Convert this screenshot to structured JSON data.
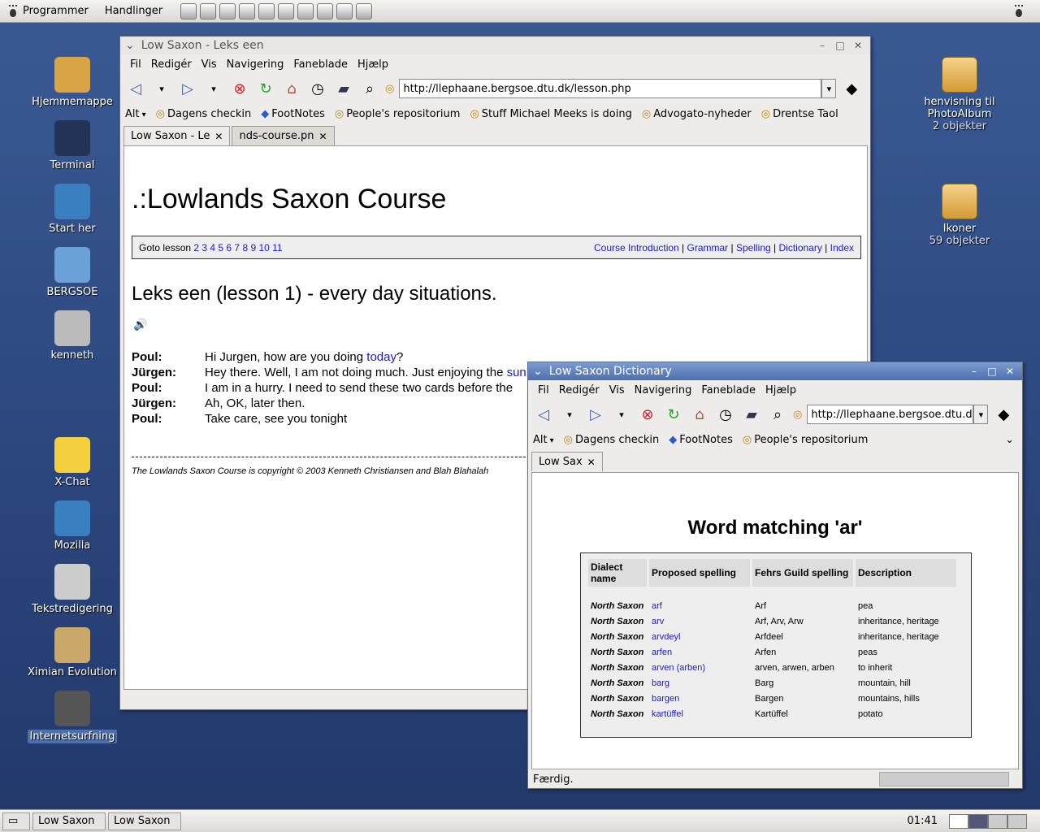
{
  "topbar": {
    "apps": "Programmer",
    "actions": "Handlinger",
    "launchers": [
      "notes-icon",
      "laptop-icon",
      "monitor-icon",
      "calculator-icon",
      "mail-icon",
      "edit-icon",
      "document-icon",
      "red-icon",
      "window-icon",
      "gnome-icon"
    ]
  },
  "desktop": {
    "left": [
      {
        "label": "Hjemmemappe",
        "icon": "home-folder-icon"
      },
      {
        "label": "Terminal",
        "icon": "terminal-icon"
      },
      {
        "label": "Start her",
        "icon": "compass-icon"
      },
      {
        "label": "BERGSOE",
        "icon": "computer-globe-icon"
      },
      {
        "label": "kenneth",
        "icon": "network-computer-icon"
      },
      {
        "label": "X-Chat",
        "icon": "chat-smiley-icon"
      },
      {
        "label": "Mozilla",
        "icon": "mozilla-globe-icon"
      },
      {
        "label": "Tekstredigering",
        "icon": "text-editor-icon"
      },
      {
        "label": "Ximian Evolution",
        "icon": "mail-envelope-icon"
      },
      {
        "label": "Internetsurfning",
        "icon": "gnome-foot-icon"
      }
    ],
    "right": [
      {
        "label": "henvisning til PhotoAlbum",
        "sub": "2 objekter"
      },
      {
        "label": "Ikoner",
        "sub": "59 objekter"
      }
    ]
  },
  "win1": {
    "title": "Low Saxon - Leks een",
    "menu": [
      "Fil",
      "Redigér",
      "Vis",
      "Navigering",
      "Faneblade",
      "Hjælp"
    ],
    "url": "http://llephaane.bergsoe.dtu.dk/lesson.php",
    "bookmarks": [
      "Alt",
      "Dagens checkin",
      "FootNotes",
      "People's repositorium",
      "Stuff Michael Meeks is doing",
      "Advogato-nyheder",
      "Drentse Taol"
    ],
    "tabs": [
      "Low Saxon - Le",
      "nds-course.pn"
    ],
    "page": {
      "heading": ".:Lowlands Saxon Course",
      "goto": "Goto lesson",
      "lessons": "2 3 4 5 6 7 8 9 10 11",
      "nav": [
        "Course Introduction",
        "Grammar",
        "Spelling",
        "Dictionary",
        "Index"
      ],
      "lesson_title": "Leks een (lesson 1) - every day situations.",
      "dialog": [
        {
          "sp": "Poul:",
          "pre": "Hi Jurgen, how are you doing ",
          "link": "today",
          "post": "?"
        },
        {
          "sp": "Jürgen:",
          "pre": "Hey there. Well, I am not doing much. Just enjoying the ",
          "link": "sun",
          "post": ""
        },
        {
          "sp": "Poul:",
          "pre": "I am in a hurry. I need to send these two cards before the",
          "link": "",
          "post": ""
        },
        {
          "sp": "Jürgen:",
          "pre": "Ah, OK, later then.",
          "link": "",
          "post": ""
        },
        {
          "sp": "Poul:",
          "pre": "Take care, see you tonight",
          "link": "",
          "post": ""
        }
      ],
      "copyright": "The Lowlands Saxon Course is copyright © 2003 Kenneth Christiansen and Blah Blahalah"
    }
  },
  "win2": {
    "title": "Low Saxon Dictionary",
    "menu": [
      "Fil",
      "Redigér",
      "Vis",
      "Navigering",
      "Faneblade",
      "Hjælp"
    ],
    "url": "http://llephaane.bergsoe.dtu.dk/s",
    "bookmarks": [
      "Alt",
      "Dagens checkin",
      "FootNotes",
      "People's repositorium"
    ],
    "tab": "Low Sax",
    "status": "Færdig.",
    "page": {
      "heading": "Word matching 'ar'",
      "columns": [
        "Dialect name",
        "Proposed spelling",
        "Fehrs Guild spelling",
        "Description"
      ],
      "rows": [
        [
          "North Saxon",
          "arf",
          "Arf",
          "pea"
        ],
        [
          "North Saxon",
          "arv",
          "Arf, Arv, Arw",
          "inheritance, heritage"
        ],
        [
          "North Saxon",
          "arvdeyl",
          "Arfdeel",
          "inheritance, heritage"
        ],
        [
          "North Saxon",
          "arfen",
          "Arfen",
          "peas"
        ],
        [
          "North Saxon",
          "arven (arben)",
          "arven, arwen, arben",
          "to inherit"
        ],
        [
          "North Saxon",
          "barg",
          "Barg",
          "mountain, hill"
        ],
        [
          "North Saxon",
          "bargen",
          "Bargen",
          "mountains, hills"
        ],
        [
          "North Saxon",
          "kartüffel",
          "Kartüffel",
          "potato"
        ]
      ]
    }
  },
  "panel": {
    "tasks": [
      "Low Saxon",
      "Low Saxon"
    ],
    "clock": "01:41"
  }
}
